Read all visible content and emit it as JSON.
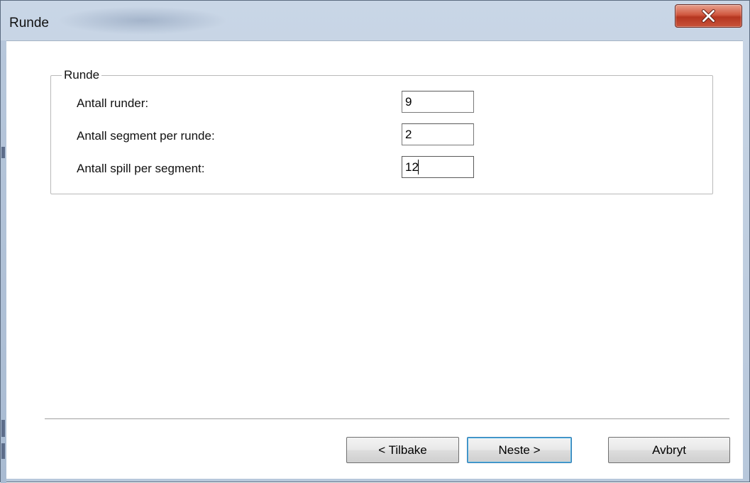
{
  "window": {
    "title": "Runde",
    "close_icon": "close-x-icon"
  },
  "group": {
    "title": "Runde",
    "fields": [
      {
        "label": "Antall runder:",
        "value": "9"
      },
      {
        "label": "Antall segment per runde:",
        "value": "2"
      },
      {
        "label": "Antall spill per segment:",
        "value": "12"
      }
    ]
  },
  "buttons": {
    "back": "< Tilbake",
    "next": "Neste >",
    "cancel": "Avbryt"
  },
  "colors": {
    "close_button": "#c8533a",
    "default_button_border": "#3c7fb1"
  }
}
